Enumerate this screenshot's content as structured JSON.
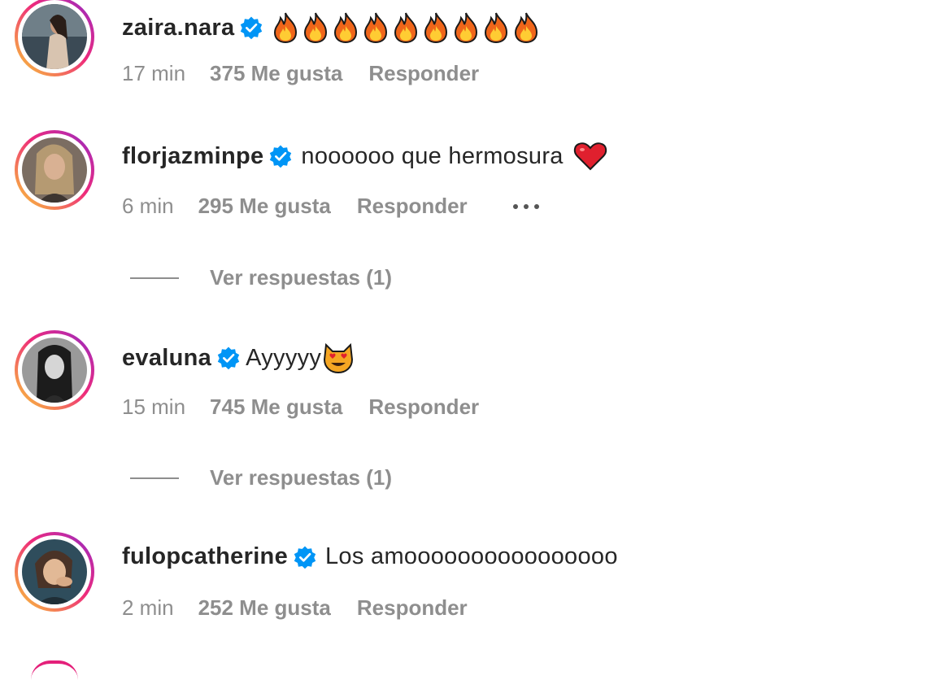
{
  "comments": [
    {
      "username": "zaira.nara",
      "text": "",
      "emoji": "fire x9",
      "time": "17 min",
      "likes": "375 Me gusta",
      "reply": "Responder"
    },
    {
      "username": "florjazminpe",
      "text": "noooooo que hermosura",
      "emoji": "red-heart",
      "time": "6 min",
      "likes": "295 Me gusta",
      "reply": "Responder",
      "view_replies": "Ver respuestas (1)"
    },
    {
      "username": "evaluna",
      "text": "Ayyyyy",
      "emoji": "heart-eyes-cat",
      "time": "15 min",
      "likes": "745 Me gusta",
      "reply": "Responder",
      "view_replies": "Ver respuestas (1)"
    },
    {
      "username": "fulopcatherine",
      "text": "Los amoooooooooooooooo",
      "time": "2 min",
      "likes": "252 Me gusta",
      "reply": "Responder"
    }
  ],
  "colors": {
    "verified": "#0095f6",
    "meta_text": "#8e8e8e",
    "story_ring_start": "#f9ce34",
    "story_ring_end": "#c32aa3"
  },
  "icons": {
    "verified": "verified-badge-icon",
    "more": "more-options-icon"
  }
}
